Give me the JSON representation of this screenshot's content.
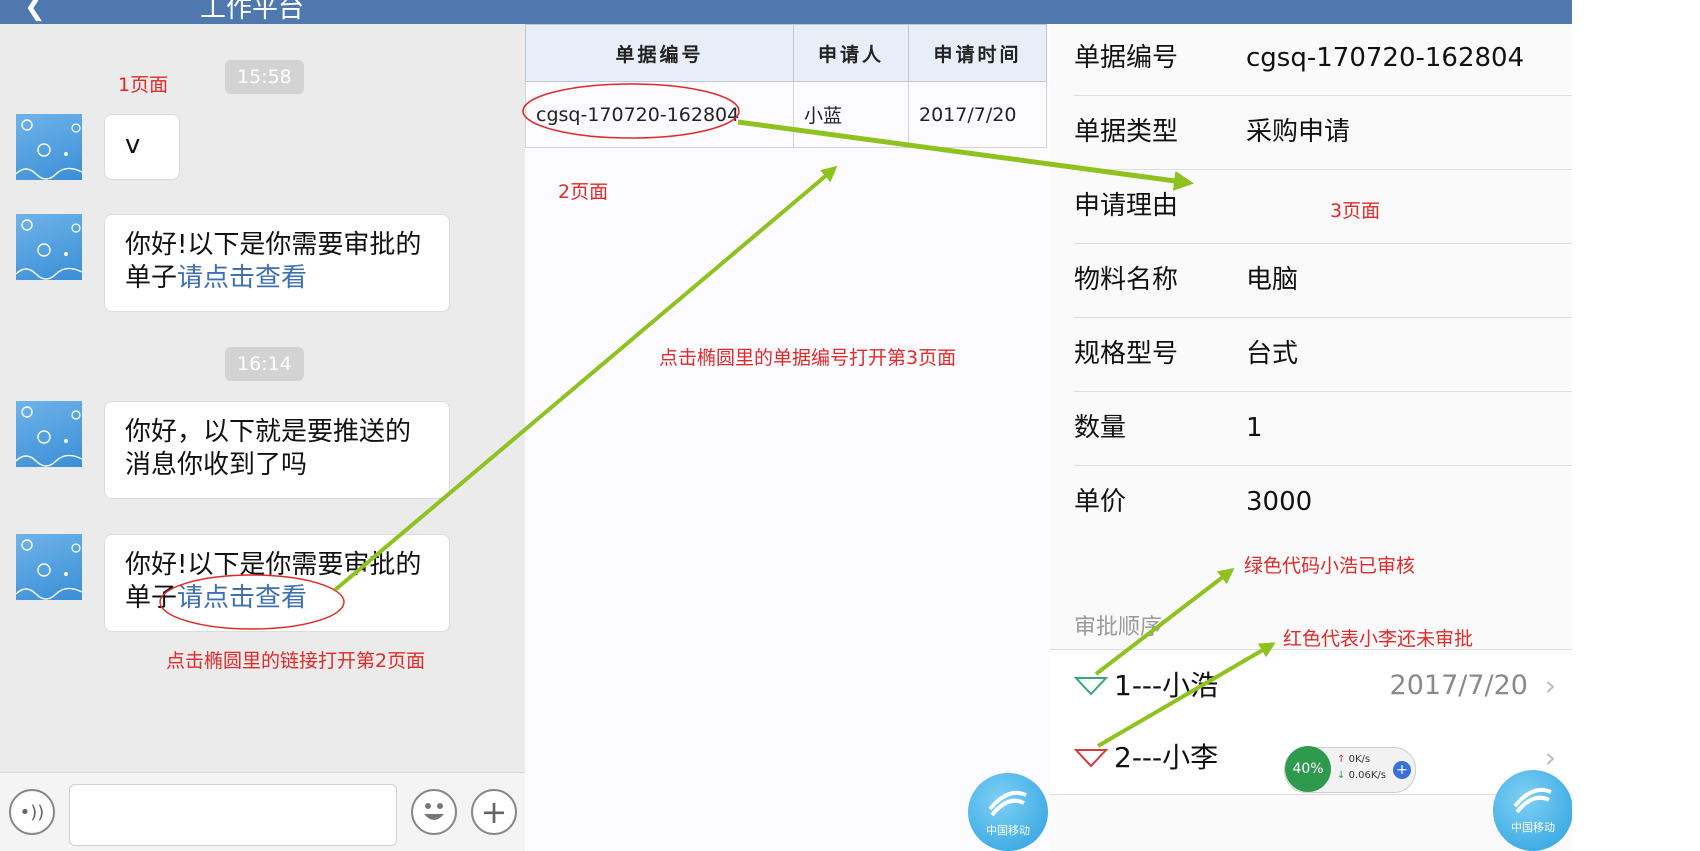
{
  "page1": {
    "header_title": "工作平台",
    "annotation_page": "1页面",
    "times": [
      "15:58",
      "16:14"
    ],
    "messages": [
      {
        "text": "v",
        "link": ""
      },
      {
        "text": "你好!以下是你需要审批的单子",
        "link": "请点击查看"
      },
      {
        "text": "你好，以下就是要推送的消息你收到了吗",
        "link": ""
      },
      {
        "text": "你好!以下是你需要审批的单子",
        "link": "请点击查看"
      }
    ],
    "annotation_link": "点击椭圆里的链接打开第2页面",
    "icons": {
      "voice": "voice-icon",
      "emoji": "emoji-icon",
      "plus": "plus-icon"
    }
  },
  "page2": {
    "annotation_page": "2页面",
    "table": {
      "headers": [
        "单据编号",
        "申请人",
        "申请时间"
      ],
      "rows": [
        [
          "cgsq-170720-162804",
          "小蓝",
          "2017/7/20"
        ]
      ]
    },
    "annotation_click": "点击椭圆里的单据编号打开第3页面",
    "logo_text": "中国移动"
  },
  "page3": {
    "annotation_page": "3页面",
    "fields": [
      {
        "label": "单据编号",
        "value": "cgsq-170720-162804"
      },
      {
        "label": "单据类型",
        "value": "采购申请"
      },
      {
        "label": "申请理由",
        "value": ""
      },
      {
        "label": "物料名称",
        "value": "电脑"
      },
      {
        "label": "规格型号",
        "value": "台式"
      },
      {
        "label": "数量",
        "value": "1"
      },
      {
        "label": "单价",
        "value": "3000"
      }
    ],
    "annotation_green": "绿色代码小浩已审核",
    "annotation_red": "红色代表小李还未审批",
    "section_title": "审批顺序",
    "approvers": [
      {
        "name": "1---小浩",
        "date": "2017/7/20",
        "status_color": "#3aa776"
      },
      {
        "name": "2---小李",
        "date": "",
        "status_color": "#d93a3a"
      }
    ],
    "speed_widget": {
      "percent": "40%",
      "up": "0K/s",
      "down": "0.06K/s"
    },
    "logo_text": "中国移动"
  },
  "colors": {
    "header": "#4f79ae",
    "link": "#3f70b0",
    "annotation": "#e02a2a",
    "arrow": "#8dc21f"
  }
}
